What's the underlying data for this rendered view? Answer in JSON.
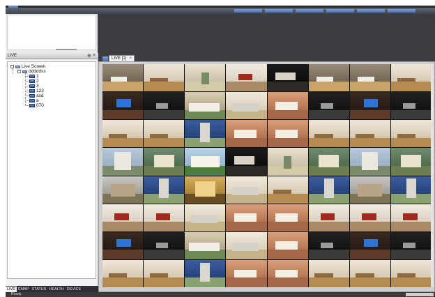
{
  "window": {
    "accent": "#4a6eb0"
  },
  "left_panel": {
    "title": "LIVE",
    "pin_icon": "pin-icon",
    "close_icon": "close-icon"
  },
  "tree": {
    "root": {
      "label": "Live Screen",
      "expanded": true,
      "icon": "server-icon"
    },
    "group": {
      "label": "dddddss",
      "expanded": true,
      "icon": "group-icon"
    },
    "cameras": [
      "1",
      "2",
      "3",
      "123",
      "asd",
      "a",
      "070"
    ]
  },
  "bottom_tabs": [
    "LIVE",
    "EMAP",
    "STATUS",
    "HEALTH",
    "DEVICE"
  ],
  "active_bottom_tab": "LIVE",
  "view_tab": {
    "label": "LIVE [1]",
    "close": "×"
  },
  "status": {
    "text": "Ready"
  },
  "grid": {
    "columns": 8,
    "rows": 8,
    "scenes": [
      [
        "bedroom",
        "livingroom",
        "hallway",
        "redroom",
        "darkroom",
        "bedroom",
        "bedroom",
        "livingroom"
      ],
      [
        "window",
        "night",
        "aerial",
        "kitchen",
        "office",
        "night",
        "window",
        "night"
      ],
      [
        "livingroom",
        "livingroom",
        "tower",
        "office",
        "office",
        "livingroom",
        "livingroom",
        "livingroom"
      ],
      [
        "building",
        "exterior",
        "villa",
        "darkroom",
        "hallway",
        "exterior",
        "building",
        "exterior"
      ],
      [
        "house",
        "tower",
        "lobby",
        "kitchen",
        "livingroom",
        "tower",
        "house",
        "tower"
      ],
      [
        "redroom",
        "redroom",
        "kitchen",
        "office",
        "office",
        "redroom",
        "redroom",
        "redroom"
      ],
      [
        "window",
        "night",
        "aerial",
        "kitchen",
        "office",
        "night",
        "window",
        "night"
      ],
      [
        "livingroom",
        "livingroom",
        "tower",
        "office",
        "office",
        "livingroom",
        "livingroom",
        "livingroom"
      ]
    ]
  }
}
